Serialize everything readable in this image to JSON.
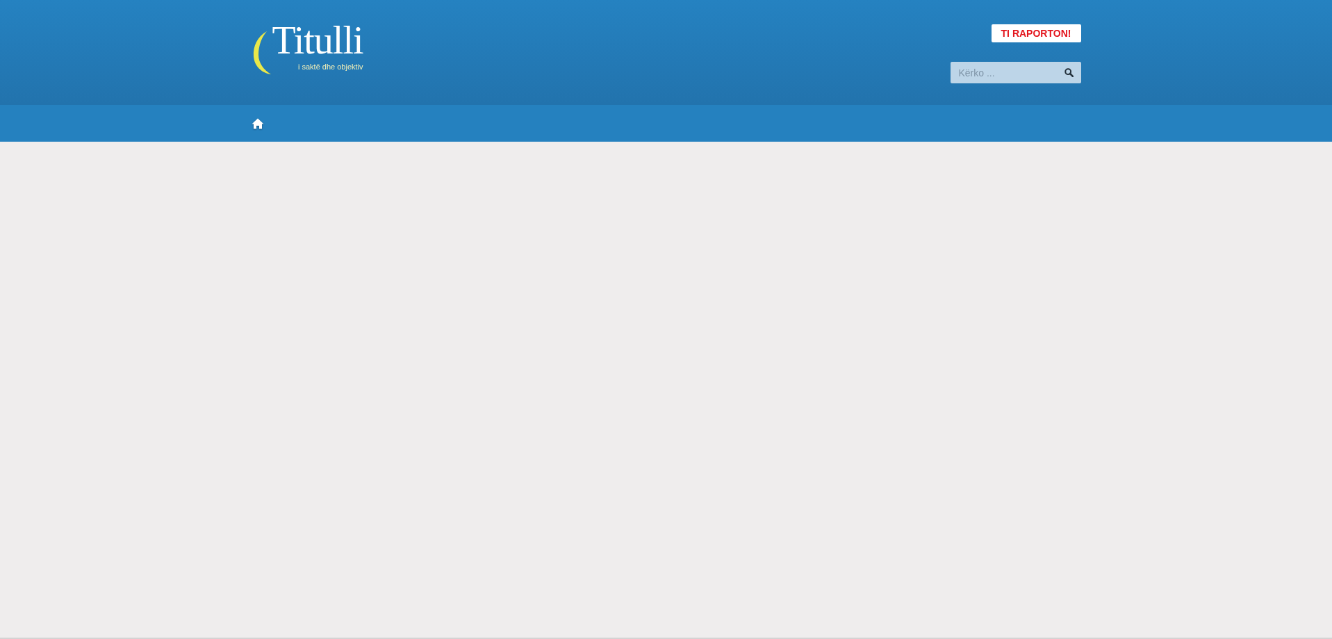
{
  "header": {
    "logo": {
      "name": "Titulli",
      "tagline": "i saktë dhe objektiv"
    },
    "report_button": {
      "label": "TI RAPORTON!"
    },
    "search": {
      "placeholder": "Kërko ..."
    }
  },
  "nav": {
    "items": [
      {
        "kind": "home"
      }
    ]
  }
}
